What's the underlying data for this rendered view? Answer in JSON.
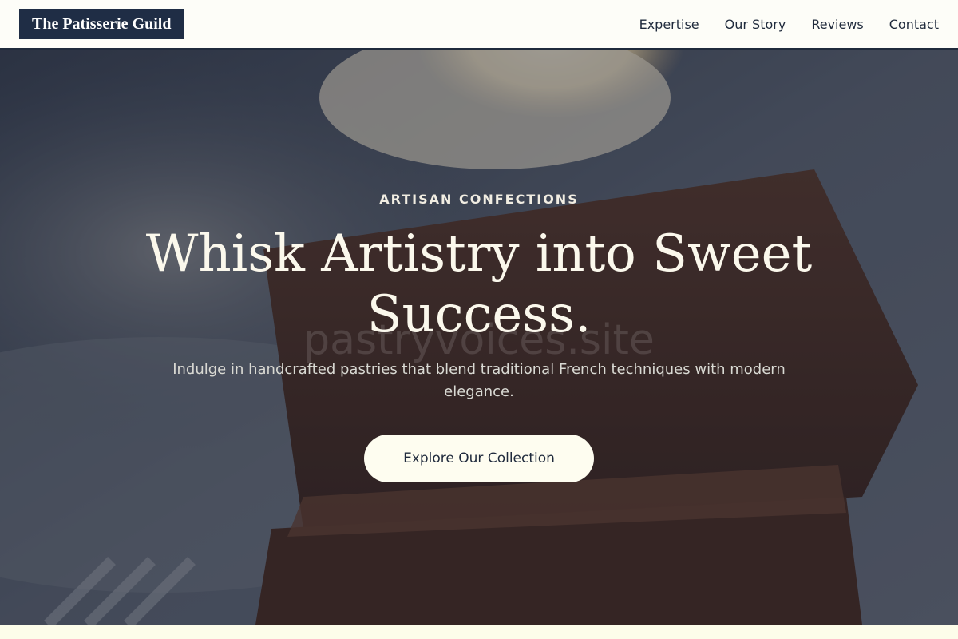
{
  "header": {
    "logo": "The Patisserie Guild",
    "nav": [
      "Expertise",
      "Our Story",
      "Reviews",
      "Contact"
    ]
  },
  "hero": {
    "eyebrow": "ARTISAN CONFECTIONS",
    "headline": "Whisk Artistry into Sweet Success.",
    "watermark": "pastryvoices.site",
    "subline": "Indulge in handcrafted pastries that blend traditional French techniques with modern elegance.",
    "cta_label": "Explore Our Collection",
    "photo": "brownie-with-ice-cream-photo"
  },
  "colors": {
    "navy": "#1f2d45",
    "cream": "#fefdf0",
    "header_bg": "#fdfdf8"
  }
}
